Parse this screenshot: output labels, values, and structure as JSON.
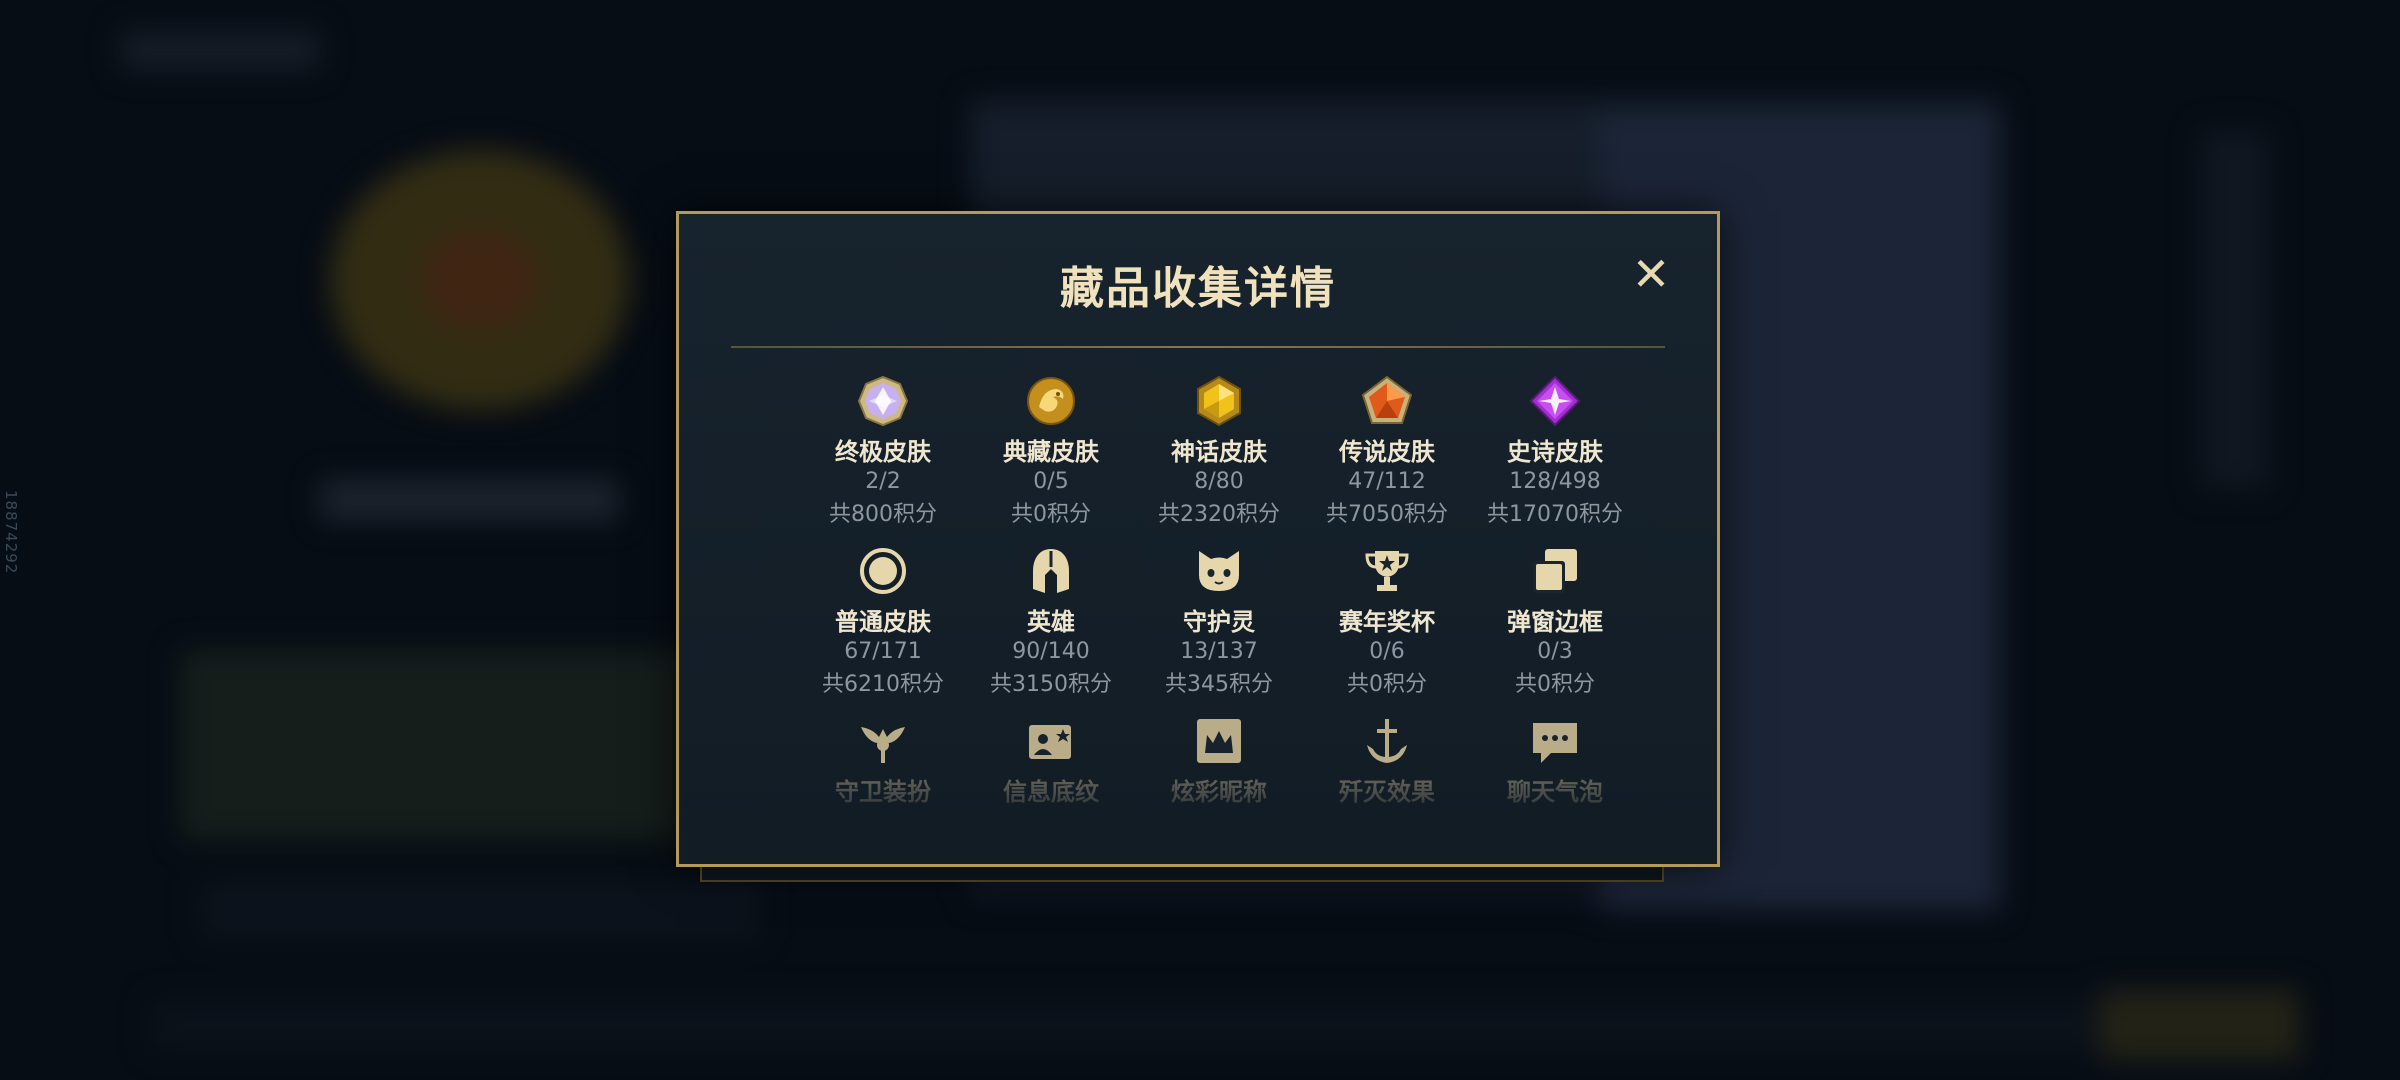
{
  "background": {
    "side_id": "18874292"
  },
  "modal": {
    "title": "藏品收集详情",
    "close_icon": "close-icon",
    "items": [
      {
        "icon": "ultimate-skin-icon",
        "label": "终极皮肤",
        "count": "2/2",
        "points": "共800积分"
      },
      {
        "icon": "treasure-skin-icon",
        "label": "典藏皮肤",
        "count": "0/5",
        "points": "共0积分"
      },
      {
        "icon": "mythic-skin-icon",
        "label": "神话皮肤",
        "count": "8/80",
        "points": "共2320积分"
      },
      {
        "icon": "legendary-skin-icon",
        "label": "传说皮肤",
        "count": "47/112",
        "points": "共7050积分"
      },
      {
        "icon": "epic-skin-icon",
        "label": "史诗皮肤",
        "count": "128/498",
        "points": "共17070积分"
      },
      {
        "icon": "normal-skin-icon",
        "label": "普通皮肤",
        "count": "67/171",
        "points": "共6210积分"
      },
      {
        "icon": "champion-helmet-icon",
        "label": "英雄",
        "count": "90/140",
        "points": "共3150积分"
      },
      {
        "icon": "guardian-icon",
        "label": "守护灵",
        "count": "13/137",
        "points": "共345积分"
      },
      {
        "icon": "trophy-icon",
        "label": "赛年奖杯",
        "count": "0/6",
        "points": "共0积分"
      },
      {
        "icon": "popup-frame-icon",
        "label": "弹窗边框",
        "count": "0/3",
        "points": "共0积分"
      },
      {
        "icon": "ward-skin-icon",
        "label": "守卫装扮"
      },
      {
        "icon": "info-card-icon",
        "label": "信息底纹"
      },
      {
        "icon": "colorful-nickname-icon",
        "label": "炫彩昵称"
      },
      {
        "icon": "elimination-effect-icon",
        "label": "歼灭效果"
      },
      {
        "icon": "chat-bubble-icon",
        "label": "聊天气泡"
      }
    ]
  },
  "colors": {
    "gold": "#b49a5a",
    "title": "#f0e2bd",
    "muted": "#8e969e"
  }
}
